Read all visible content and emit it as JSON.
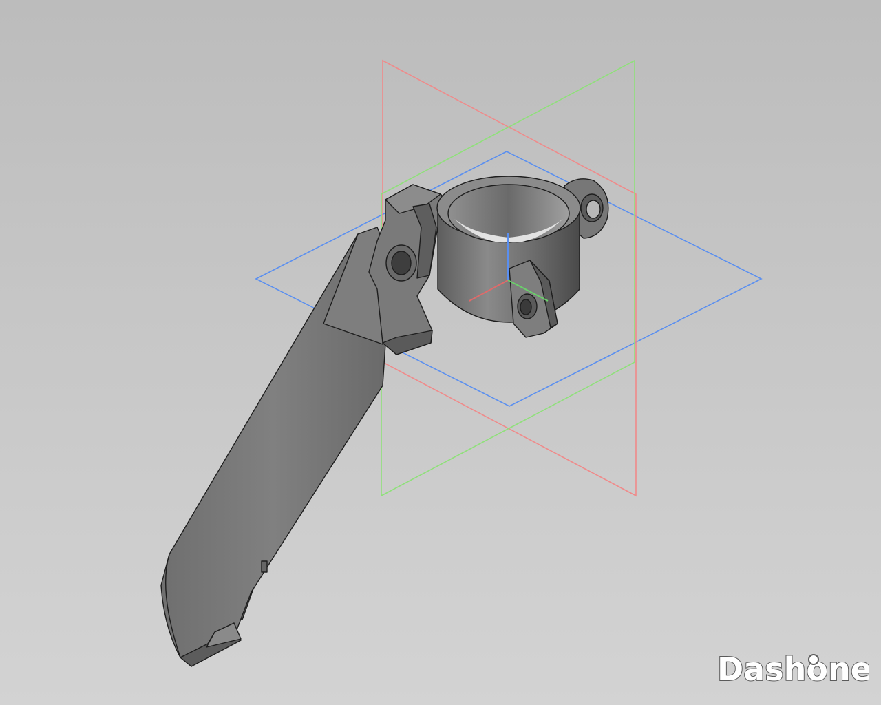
{
  "viewport": {
    "background_top": "#bcbcbc",
    "background_bottom": "#d3d3d3"
  },
  "planes": {
    "xy_color": "#5a8ff0",
    "xz_color": "#f08a8a",
    "yz_color": "#8fe07a"
  },
  "triad": {
    "x_color": "#e06a6a",
    "y_color": "#6ad06a",
    "z_color": "#5a8ff0"
  },
  "model": {
    "base_color": "#7b7b7b",
    "light_color": "#a2a2a2",
    "dark_color": "#4d4d4d",
    "edge_color": "#1e1e1e"
  },
  "watermark": {
    "text": "Dashone",
    "icon": "gear-icon",
    "fill": "#ffffff",
    "stroke": "#5a5a5a"
  }
}
